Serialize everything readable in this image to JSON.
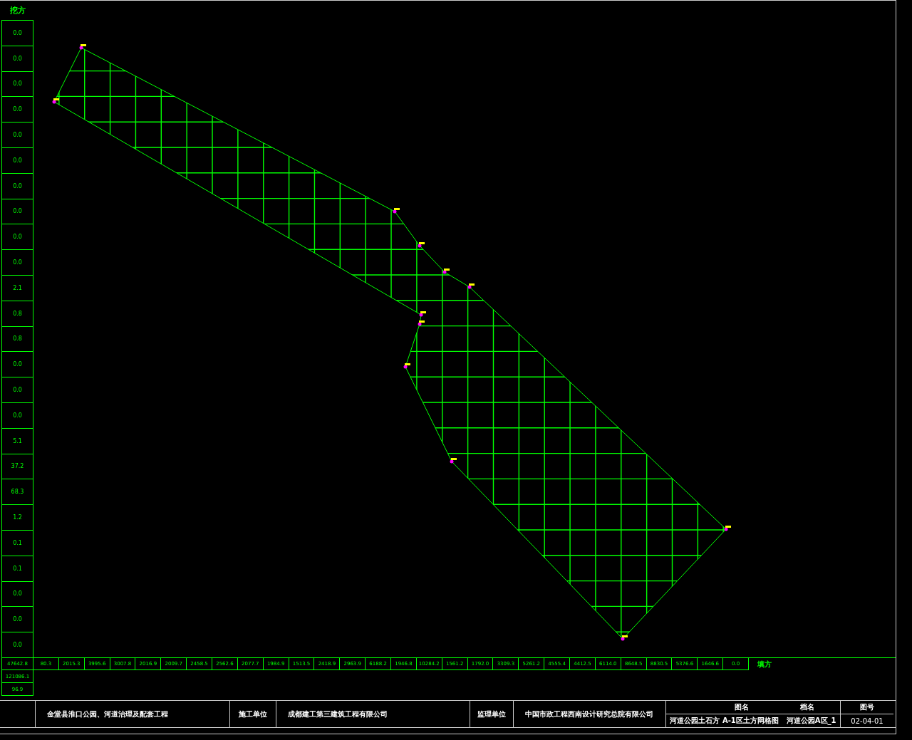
{
  "left_column": {
    "label": "挖方",
    "values": [
      "0.0",
      "0.0",
      "0.0",
      "0.0",
      "0.0",
      "0.0",
      "0.0",
      "0.0",
      "0.0",
      "0.0",
      "2.1",
      "0.8",
      "0.8",
      "0.0",
      "0.0",
      "0.0",
      "5.1",
      "37.2",
      "68.3",
      "1.2",
      "0.1",
      "0.1",
      "0.0",
      "0.0",
      "0.0"
    ]
  },
  "bottom_row": {
    "label": "填方",
    "values": [
      "80.3",
      "2015.3",
      "3995.6",
      "3007.8",
      "2016.9",
      "2009.7",
      "2458.5",
      "2562.6",
      "2077.7",
      "1984.9",
      "1513.5",
      "2418.9",
      "2963.9",
      "6188.2",
      "1946.8",
      "10284.2",
      "1561.2",
      "1792.0",
      "3309.3",
      "5261.2",
      "4555.4",
      "4412.5",
      "6114.0",
      "8648.5",
      "8830.5",
      "5376.6",
      "1646.6",
      "0.0"
    ]
  },
  "totals": [
    "47642.8",
    "121086.1",
    "96.9"
  ],
  "title_block": {
    "project": "金堂县淮口公园、河道治理及配套工程",
    "builder_label": "施工单位",
    "builder": "成都建工第三建筑工程有限公司",
    "supervisor_label": "监理单位",
    "supervisor": "中国市政工程西南设计研究总院有限公司",
    "drawing_name_label": "图名",
    "file_name_label": "档名",
    "drawing_name": "河道公园土石方 A-1区土方网格图",
    "file_name": "河道公园A区_1",
    "number_label": "图号",
    "number": "02-04-01"
  }
}
